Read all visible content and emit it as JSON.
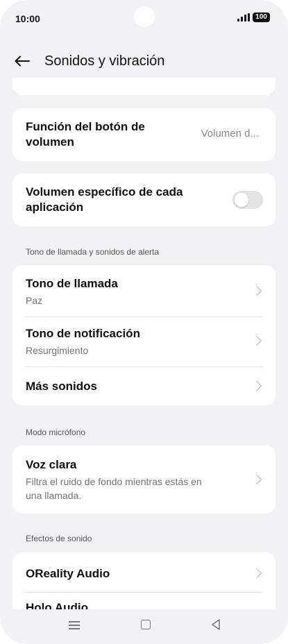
{
  "status_bar": {
    "time": "10:00",
    "battery": "100",
    "signal_icon": "signal-icon"
  },
  "header": {
    "title": "Sonidos y vibración",
    "back_icon": "back-arrow-icon"
  },
  "volume_button": {
    "title_line1": "Función del botón de",
    "title_line2": "volumen",
    "value": "Volumen d..."
  },
  "app_volume": {
    "title_line1": "Volumen específico de cada",
    "title_line2": "aplicación",
    "enabled": false
  },
  "ringtones_section": {
    "label": "Tono de llamada y sonidos de alerta",
    "items": [
      {
        "title": "Tono de llamada",
        "subtitle": "Paz"
      },
      {
        "title": "Tono de notificación",
        "subtitle": "Resurgimiento"
      },
      {
        "title": "Más sonidos",
        "subtitle": ""
      }
    ]
  },
  "mic_section": {
    "label": "Modo micrófono",
    "item": {
      "title": "Voz clara",
      "subtitle_line1": "Filtra el ruido de fondo mientras estás en",
      "subtitle_line2": "una llamada."
    }
  },
  "effects_section": {
    "label": "Efectos de sonido",
    "items": [
      {
        "title": "OReality Audio"
      },
      {
        "title": "Holo Audio"
      }
    ]
  },
  "nav": {
    "menu_icon": "menu-icon",
    "home_icon": "home-icon",
    "back_icon": "back-triangle-icon"
  },
  "colors": {
    "background": "#f2f2f4",
    "card": "#ffffff",
    "toggle_off": "#e3e3e5",
    "secondary_text": "#757575"
  }
}
